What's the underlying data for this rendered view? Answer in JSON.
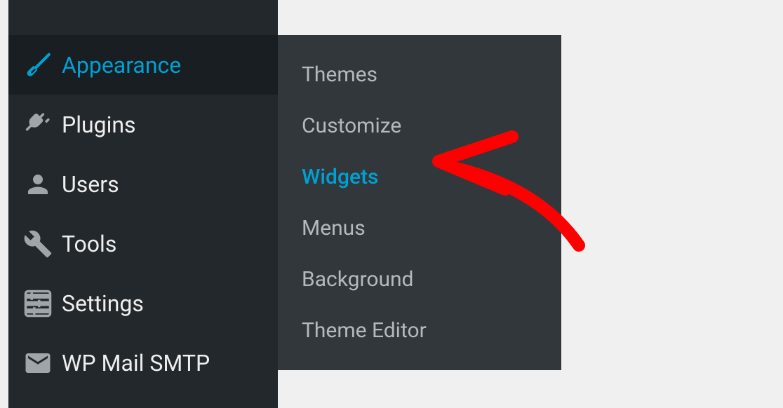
{
  "sidebar": {
    "items": [
      {
        "label": "Appearance",
        "icon": "paintbrush",
        "active": true
      },
      {
        "label": "Plugins",
        "icon": "plug",
        "active": false
      },
      {
        "label": "Users",
        "icon": "user",
        "active": false
      },
      {
        "label": "Tools",
        "icon": "wrench",
        "active": false
      },
      {
        "label": "Settings",
        "icon": "sliders",
        "active": false
      },
      {
        "label": "WP Mail SMTP",
        "icon": "envelope",
        "active": false
      }
    ]
  },
  "submenu": {
    "items": [
      {
        "label": "Themes",
        "active": false
      },
      {
        "label": "Customize",
        "active": false
      },
      {
        "label": "Widgets",
        "active": true
      },
      {
        "label": "Menus",
        "active": false
      },
      {
        "label": "Background",
        "active": false
      },
      {
        "label": "Theme Editor",
        "active": false
      }
    ]
  },
  "colors": {
    "accent": "#00a0d2",
    "sidebarBg": "#23282d",
    "sidebarActiveBg": "#191e23",
    "submenuBg": "#32373c"
  }
}
